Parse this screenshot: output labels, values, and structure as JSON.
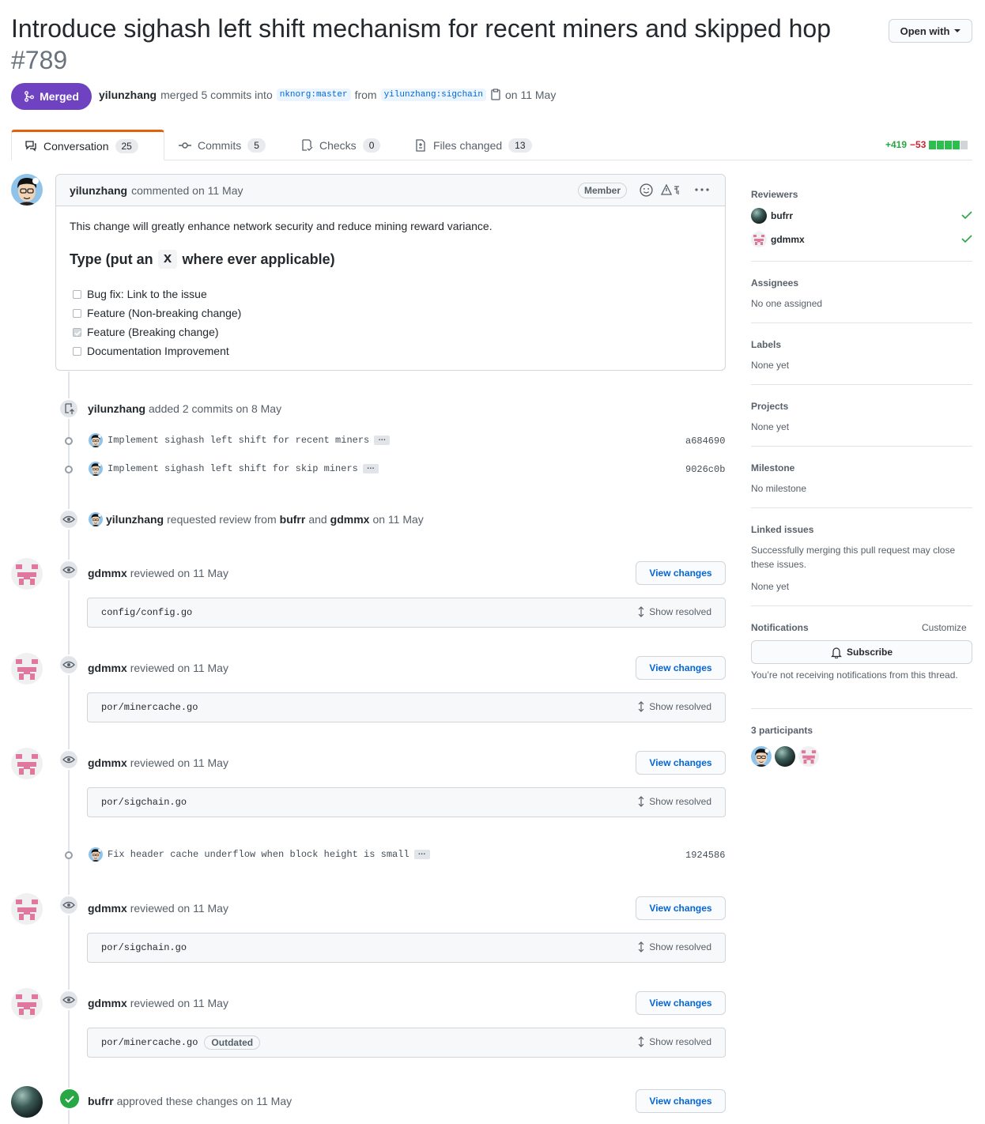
{
  "pr": {
    "title": "Introduce sighash left shift mechanism for recent miners and skipped hop",
    "number": "#789",
    "state": "Merged",
    "open_with": "Open with",
    "author": "yilunzhang",
    "merged_text": "merged 5 commits into",
    "base_branch": "nknorg:master",
    "from": "from",
    "head_branch": "yilunzhang:sigchain",
    "date": "on 11 May"
  },
  "tabs": [
    {
      "label": "Conversation",
      "count": "25"
    },
    {
      "label": "Commits",
      "count": "5"
    },
    {
      "label": "Checks",
      "count": "0"
    },
    {
      "label": "Files changed",
      "count": "13"
    }
  ],
  "diffstat": {
    "additions": "+419",
    "deletions": "−53"
  },
  "comment": {
    "author": "yilunzhang",
    "date": "commented on 11 May",
    "role": "Member",
    "body": "This change will greatly enhance network security and reduce mining reward variance.",
    "heading_pre": "Type (put an",
    "heading_code": "x",
    "heading_post": "where ever applicable)",
    "checklist": [
      {
        "label": "Bug fix: Link to the issue",
        "checked": false
      },
      {
        "label": "Feature (Non-breaking change)",
        "checked": false
      },
      {
        "label": "Feature (Breaking change)",
        "checked": true
      },
      {
        "label": "Documentation Improvement",
        "checked": false
      }
    ]
  },
  "commits_event": {
    "author": "yilunzhang",
    "text": "added 2 commits on 8 May"
  },
  "commits": [
    {
      "message": "Implement sighash left shift for recent miners",
      "sha": "a684690"
    },
    {
      "message": "Implement sighash left shift for skip miners",
      "sha": "9026c0b"
    },
    {
      "message": "Fix header cache underflow when block height is small",
      "sha": "1924586"
    }
  ],
  "review_request": {
    "author": "yilunzhang",
    "text1": "requested review from",
    "r1": "bufrr",
    "and": "and",
    "r2": "gdmmx",
    "date": "on 11 May"
  },
  "reviews": [
    {
      "author": "gdmmx",
      "text": "reviewed on 11 May",
      "file": "config/config.go",
      "button": "View changes",
      "resolved": "Show resolved",
      "outdated": ""
    },
    {
      "author": "gdmmx",
      "text": "reviewed on 11 May",
      "file": "por/minercache.go",
      "button": "View changes",
      "resolved": "Show resolved",
      "outdated": ""
    },
    {
      "author": "gdmmx",
      "text": "reviewed on 11 May",
      "file": "por/sigchain.go",
      "button": "View changes",
      "resolved": "Show resolved",
      "outdated": ""
    },
    {
      "author": "gdmmx",
      "text": "reviewed on 11 May",
      "file": "por/sigchain.go",
      "button": "View changes",
      "resolved": "Show resolved",
      "outdated": ""
    },
    {
      "author": "gdmmx",
      "text": "reviewed on 11 May",
      "file": "por/minercache.go",
      "button": "View changes",
      "resolved": "Show resolved",
      "outdated": "Outdated"
    }
  ],
  "approval": {
    "author": "bufrr",
    "text": "approved these changes on 11 May",
    "button": "View changes"
  },
  "sidebar": {
    "reviewers_title": "Reviewers",
    "reviewers": [
      "bufrr",
      "gdmmx"
    ],
    "assignees_title": "Assignees",
    "assignees_value": "No one assigned",
    "labels_title": "Labels",
    "labels_value": "None yet",
    "projects_title": "Projects",
    "projects_value": "None yet",
    "milestone_title": "Milestone",
    "milestone_value": "No milestone",
    "linked_title": "Linked issues",
    "linked_desc": "Successfully merging this pull request may close these issues.",
    "linked_value": "None yet",
    "notifications_title": "Notifications",
    "customize": "Customize",
    "subscribe": "Subscribe",
    "notifications_desc": "You’re not receiving notifications from this thread.",
    "participants_title": "3 participants"
  },
  "colors": {
    "merged": "#6f42c1",
    "link": "#0366d6",
    "add": "#28a745",
    "del": "#cb2431",
    "pink": "#e0779e"
  },
  "icons": [
    "git-merge-icon",
    "copy-icon",
    "comment-discussion-icon",
    "git-commit-icon",
    "checklist-icon",
    "file-diff-icon",
    "smiley-icon",
    "kebab-horizontal-icon",
    "repo-push-icon",
    "eye-icon",
    "unfold-icon",
    "check-icon",
    "bell-icon"
  ]
}
